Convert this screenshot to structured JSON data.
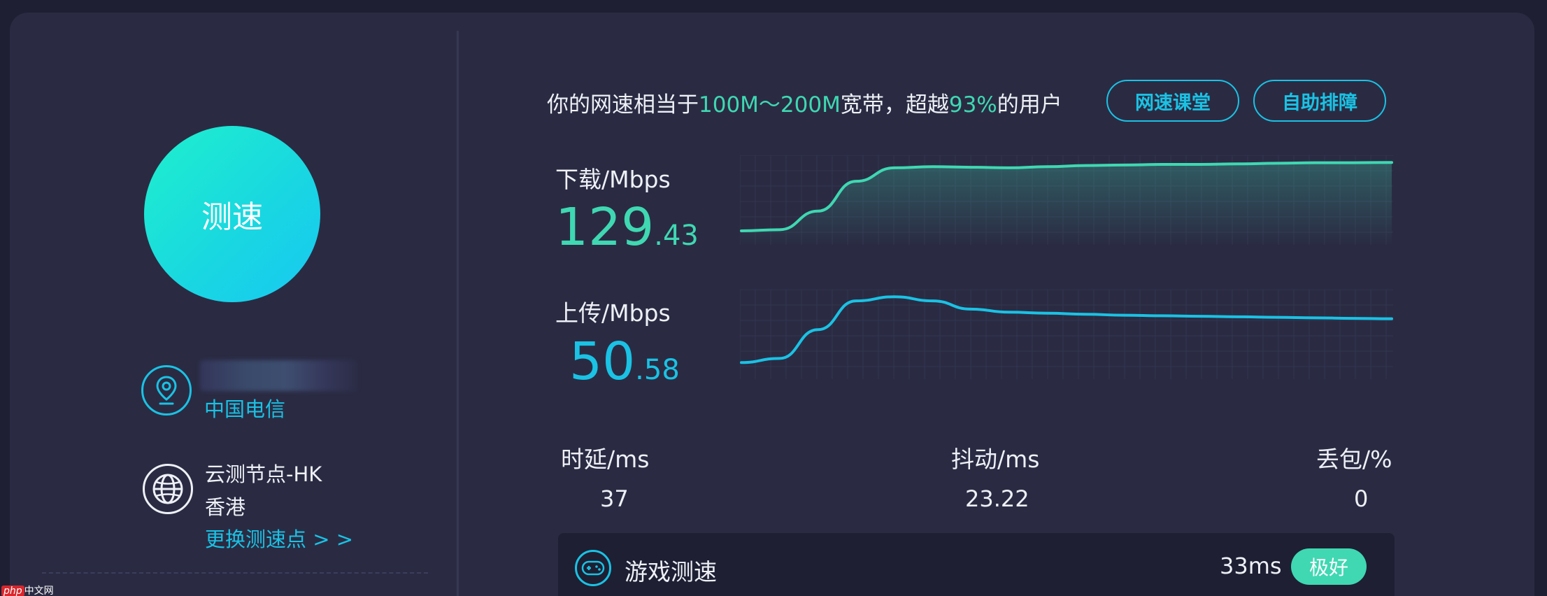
{
  "left": {
    "test_button_label": "测速",
    "isp": "中国电信",
    "node_name": "云测节点-HK",
    "node_city": "香港",
    "change_node_link": "更换测速点 > >"
  },
  "summary": {
    "prefix": "你的网速相当于",
    "bandwidth": "100M～200M",
    "middle": "宽带，超越",
    "percent": "93%",
    "suffix": "的用户"
  },
  "buttons": {
    "network_class": "网速课堂",
    "self_help": "自助排障"
  },
  "download": {
    "label": "下载/Mbps",
    "value_int": "129",
    "value_dec": ".43",
    "color": "#3fd8b2"
  },
  "upload": {
    "label": "上传/Mbps",
    "value_int": "50",
    "value_dec": ".58",
    "color": "#1ac2e4"
  },
  "chart_data": [
    {
      "type": "area",
      "series": [
        {
          "values": [
            10,
            12,
            45,
            98,
            122,
            124,
            123,
            122,
            124,
            126,
            127,
            128,
            128,
            129,
            130,
            131,
            131,
            131.5
          ]
        }
      ]
    },
    {
      "type": "line",
      "series": [
        {
          "values": [
            8,
            12,
            40,
            68,
            72,
            68,
            60,
            57,
            56,
            55,
            54,
            53.5,
            53,
            52.5,
            52,
            51.5,
            51,
            50.6
          ]
        }
      ]
    }
  ],
  "stats": {
    "latency_label": "时延/ms",
    "latency_value": "37",
    "jitter_label": "抖动/ms",
    "jitter_value": "23.22",
    "loss_label": "丢包/%",
    "loss_value": "0"
  },
  "game": {
    "label": "游戏测速",
    "ping": "33ms",
    "rating": "极好"
  },
  "watermark": {
    "brand": "php",
    "site": "中文网"
  }
}
